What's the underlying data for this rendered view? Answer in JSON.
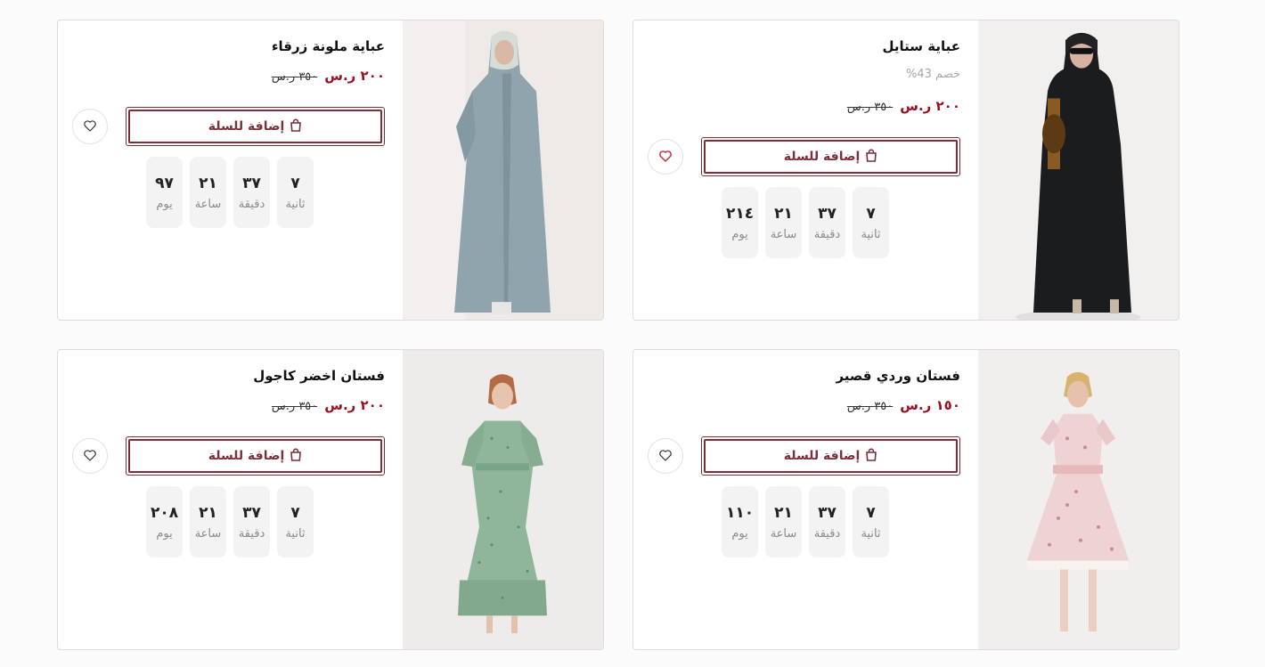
{
  "products": [
    {
      "title": "عباية ستايل",
      "discount": "خصم 43%",
      "price_now": "٢٠٠ ر.س",
      "price_old": "٣٥٠ ر.س",
      "add_to_cart": "إضافة للسلة",
      "wishlist_active": true,
      "timer": [
        {
          "value": "٧",
          "label": "ثانية"
        },
        {
          "value": "٣٧",
          "label": "دقيقة"
        },
        {
          "value": "٢١",
          "label": "ساعة"
        },
        {
          "value": "٢١٤",
          "label": "يوم"
        }
      ]
    },
    {
      "title": "عباية ملونة زرقاء",
      "price_now": "٢٠٠ ر.س",
      "price_old": "٣٥٠ ر.س",
      "add_to_cart": "إضافة للسلة",
      "wishlist_active": false,
      "timer": [
        {
          "value": "٧",
          "label": "ثانية"
        },
        {
          "value": "٣٧",
          "label": "دقيقة"
        },
        {
          "value": "٢١",
          "label": "ساعة"
        },
        {
          "value": "٩٧",
          "label": "يوم"
        }
      ]
    },
    {
      "title": "فستان وردي قصير",
      "price_now": "١٥٠ ر.س",
      "price_old": "٣٥٠ ر.س",
      "add_to_cart": "إضافة للسلة",
      "wishlist_active": false,
      "timer": [
        {
          "value": "٧",
          "label": "ثانية"
        },
        {
          "value": "٣٧",
          "label": "دقيقة"
        },
        {
          "value": "٢١",
          "label": "ساعة"
        },
        {
          "value": "١١٠",
          "label": "يوم"
        }
      ]
    },
    {
      "title": "فستان اخضر كاجول",
      "price_now": "٢٠٠ ر.س",
      "price_old": "٣٥٠ ر.س",
      "add_to_cart": "إضافة للسلة",
      "wishlist_active": false,
      "timer": [
        {
          "value": "٧",
          "label": "ثانية"
        },
        {
          "value": "٣٧",
          "label": "دقيقة"
        },
        {
          "value": "٢١",
          "label": "ساعة"
        },
        {
          "value": "٢٠٨",
          "label": "يوم"
        }
      ]
    }
  ],
  "colors": {
    "brand": "#7b2f38",
    "price": "#9b1020",
    "wishlist_active": "#c0283a"
  },
  "icons": {
    "cart": "shopping-bag-icon",
    "wishlist": "heart-icon"
  }
}
